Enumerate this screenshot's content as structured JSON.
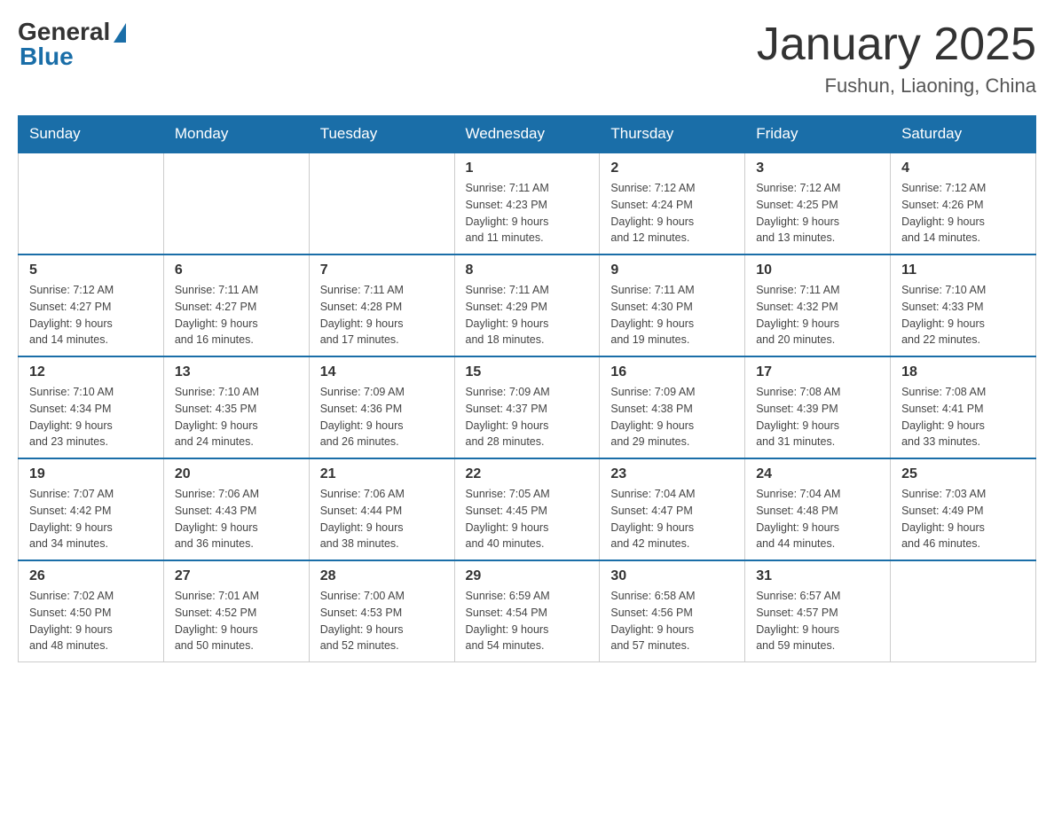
{
  "header": {
    "logo_general": "General",
    "logo_blue": "Blue",
    "title": "January 2025",
    "subtitle": "Fushun, Liaoning, China"
  },
  "days_of_week": [
    "Sunday",
    "Monday",
    "Tuesday",
    "Wednesday",
    "Thursday",
    "Friday",
    "Saturday"
  ],
  "weeks": [
    {
      "days": [
        {
          "num": "",
          "info": ""
        },
        {
          "num": "",
          "info": ""
        },
        {
          "num": "",
          "info": ""
        },
        {
          "num": "1",
          "info": "Sunrise: 7:11 AM\nSunset: 4:23 PM\nDaylight: 9 hours\nand 11 minutes."
        },
        {
          "num": "2",
          "info": "Sunrise: 7:12 AM\nSunset: 4:24 PM\nDaylight: 9 hours\nand 12 minutes."
        },
        {
          "num": "3",
          "info": "Sunrise: 7:12 AM\nSunset: 4:25 PM\nDaylight: 9 hours\nand 13 minutes."
        },
        {
          "num": "4",
          "info": "Sunrise: 7:12 AM\nSunset: 4:26 PM\nDaylight: 9 hours\nand 14 minutes."
        }
      ]
    },
    {
      "days": [
        {
          "num": "5",
          "info": "Sunrise: 7:12 AM\nSunset: 4:27 PM\nDaylight: 9 hours\nand 14 minutes."
        },
        {
          "num": "6",
          "info": "Sunrise: 7:11 AM\nSunset: 4:27 PM\nDaylight: 9 hours\nand 16 minutes."
        },
        {
          "num": "7",
          "info": "Sunrise: 7:11 AM\nSunset: 4:28 PM\nDaylight: 9 hours\nand 17 minutes."
        },
        {
          "num": "8",
          "info": "Sunrise: 7:11 AM\nSunset: 4:29 PM\nDaylight: 9 hours\nand 18 minutes."
        },
        {
          "num": "9",
          "info": "Sunrise: 7:11 AM\nSunset: 4:30 PM\nDaylight: 9 hours\nand 19 minutes."
        },
        {
          "num": "10",
          "info": "Sunrise: 7:11 AM\nSunset: 4:32 PM\nDaylight: 9 hours\nand 20 minutes."
        },
        {
          "num": "11",
          "info": "Sunrise: 7:10 AM\nSunset: 4:33 PM\nDaylight: 9 hours\nand 22 minutes."
        }
      ]
    },
    {
      "days": [
        {
          "num": "12",
          "info": "Sunrise: 7:10 AM\nSunset: 4:34 PM\nDaylight: 9 hours\nand 23 minutes."
        },
        {
          "num": "13",
          "info": "Sunrise: 7:10 AM\nSunset: 4:35 PM\nDaylight: 9 hours\nand 24 minutes."
        },
        {
          "num": "14",
          "info": "Sunrise: 7:09 AM\nSunset: 4:36 PM\nDaylight: 9 hours\nand 26 minutes."
        },
        {
          "num": "15",
          "info": "Sunrise: 7:09 AM\nSunset: 4:37 PM\nDaylight: 9 hours\nand 28 minutes."
        },
        {
          "num": "16",
          "info": "Sunrise: 7:09 AM\nSunset: 4:38 PM\nDaylight: 9 hours\nand 29 minutes."
        },
        {
          "num": "17",
          "info": "Sunrise: 7:08 AM\nSunset: 4:39 PM\nDaylight: 9 hours\nand 31 minutes."
        },
        {
          "num": "18",
          "info": "Sunrise: 7:08 AM\nSunset: 4:41 PM\nDaylight: 9 hours\nand 33 minutes."
        }
      ]
    },
    {
      "days": [
        {
          "num": "19",
          "info": "Sunrise: 7:07 AM\nSunset: 4:42 PM\nDaylight: 9 hours\nand 34 minutes."
        },
        {
          "num": "20",
          "info": "Sunrise: 7:06 AM\nSunset: 4:43 PM\nDaylight: 9 hours\nand 36 minutes."
        },
        {
          "num": "21",
          "info": "Sunrise: 7:06 AM\nSunset: 4:44 PM\nDaylight: 9 hours\nand 38 minutes."
        },
        {
          "num": "22",
          "info": "Sunrise: 7:05 AM\nSunset: 4:45 PM\nDaylight: 9 hours\nand 40 minutes."
        },
        {
          "num": "23",
          "info": "Sunrise: 7:04 AM\nSunset: 4:47 PM\nDaylight: 9 hours\nand 42 minutes."
        },
        {
          "num": "24",
          "info": "Sunrise: 7:04 AM\nSunset: 4:48 PM\nDaylight: 9 hours\nand 44 minutes."
        },
        {
          "num": "25",
          "info": "Sunrise: 7:03 AM\nSunset: 4:49 PM\nDaylight: 9 hours\nand 46 minutes."
        }
      ]
    },
    {
      "days": [
        {
          "num": "26",
          "info": "Sunrise: 7:02 AM\nSunset: 4:50 PM\nDaylight: 9 hours\nand 48 minutes."
        },
        {
          "num": "27",
          "info": "Sunrise: 7:01 AM\nSunset: 4:52 PM\nDaylight: 9 hours\nand 50 minutes."
        },
        {
          "num": "28",
          "info": "Sunrise: 7:00 AM\nSunset: 4:53 PM\nDaylight: 9 hours\nand 52 minutes."
        },
        {
          "num": "29",
          "info": "Sunrise: 6:59 AM\nSunset: 4:54 PM\nDaylight: 9 hours\nand 54 minutes."
        },
        {
          "num": "30",
          "info": "Sunrise: 6:58 AM\nSunset: 4:56 PM\nDaylight: 9 hours\nand 57 minutes."
        },
        {
          "num": "31",
          "info": "Sunrise: 6:57 AM\nSunset: 4:57 PM\nDaylight: 9 hours\nand 59 minutes."
        },
        {
          "num": "",
          "info": ""
        }
      ]
    }
  ]
}
